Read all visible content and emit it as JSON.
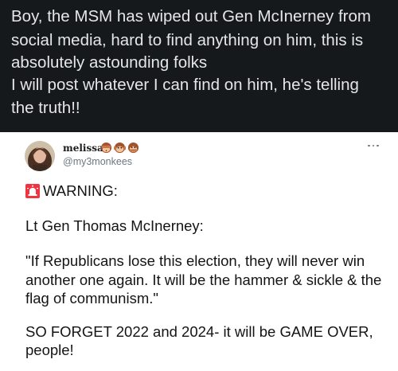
{
  "caption": {
    "lines": [
      "Boy, the MSM has wiped out Gen McInerney from",
      "social media, hard to find anything on him, this is",
      "absolutely astounding folks",
      "I will post whatever I can find on him, he's telling",
      "the truth!!"
    ]
  },
  "tweet": {
    "display_name": "melissa",
    "display_name_emojis": [
      "see-no-evil-monkey-icon",
      "hear-no-evil-monkey-icon",
      "speak-no-evil-monkey-icon"
    ],
    "handle": "@my3monkees",
    "warning_icon": "rotating-light-icon",
    "warning_label": "WARNING:",
    "lines": [
      "Lt Gen Thomas McInerney:",
      "\"If Republicans lose this election, they will never win",
      "another one again. It will be the hammer & sickle & the",
      "flag of communism.\"",
      "SO FORGET 2022 and 2024- it will be GAME OVER,",
      "people!"
    ]
  },
  "colors": {
    "caption_background": "#16191c",
    "caption_text": "#e4e6e8",
    "card_background": "#ffffff",
    "tweet_text": "#141414",
    "handle_text": "#6b7780",
    "warning_icon": "#e0245e"
  }
}
